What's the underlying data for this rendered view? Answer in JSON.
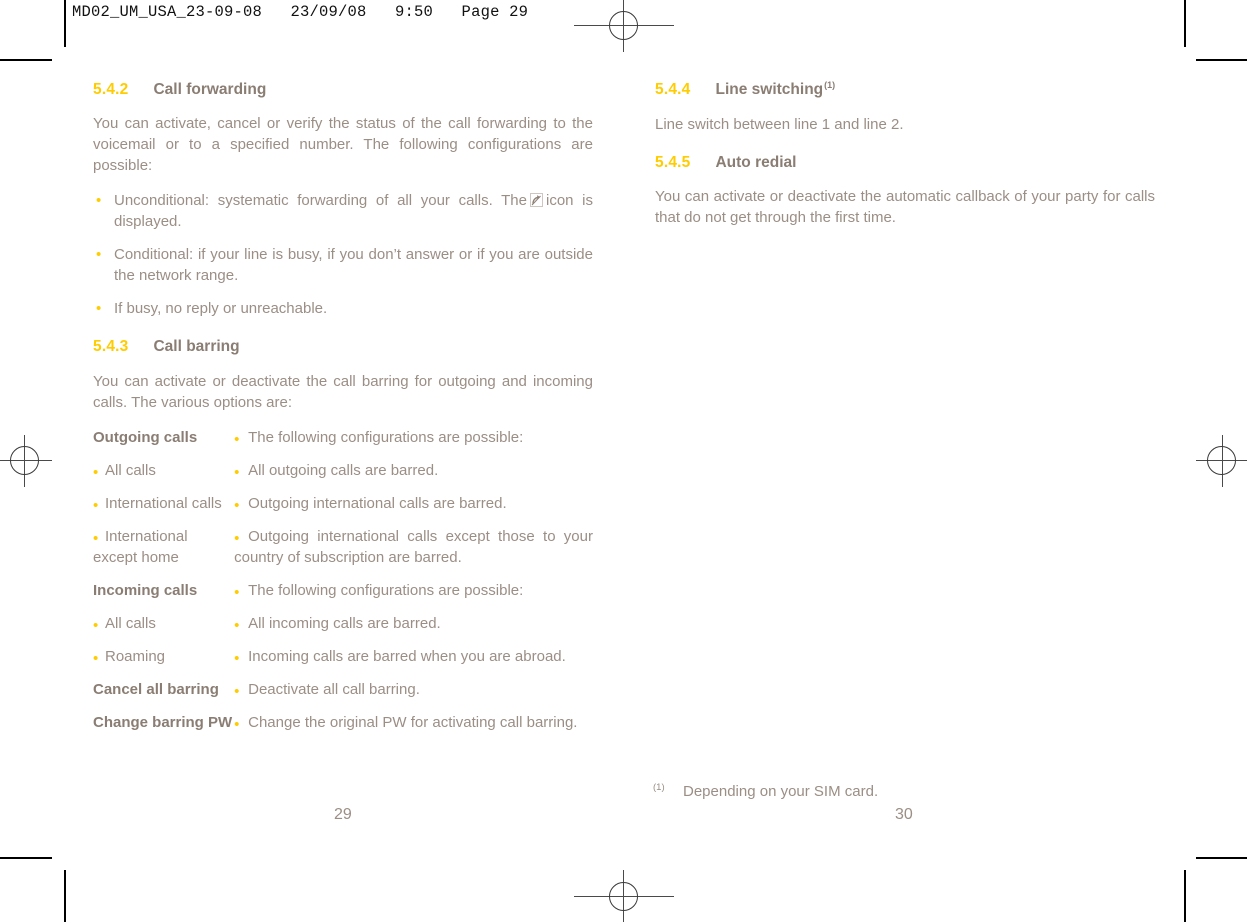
{
  "slug": {
    "text": "MD02_UM_USA_23-09-08   23/09/08   9:50   Page 29"
  },
  "colors": {
    "section_number": "#ffcc00",
    "heading": "#8a7d73",
    "body": "#9b8e85",
    "bullet": "#ffcc00"
  },
  "left_page": {
    "sections": [
      {
        "number": "5.4.2",
        "title": "Call forwarding",
        "intro": "You can activate, cancel or verify the status of the call forwarding to the voicemail or to a specified number. The following configurations are possible:",
        "bullets": [
          {
            "before": "Unconditional: systematic forwarding of all your calls. The",
            "icon": "call-forward-icon",
            "after": "icon is displayed."
          },
          {
            "text": "Conditional: if your line is busy, if you don’t answer or if you are outside the network range."
          },
          {
            "text": "If busy, no reply or unreachable."
          }
        ]
      },
      {
        "number": "5.4.3",
        "title": "Call barring",
        "intro": "You can activate or deactivate the call barring for outgoing and incoming calls. The various options are:"
      }
    ],
    "options_table": {
      "rows": [
        {
          "label": "Outgoing calls",
          "label_bold": true,
          "label_bullet": false,
          "value": "The following configurations are possible:"
        },
        {
          "label": "All calls",
          "label_bold": false,
          "label_bullet": true,
          "value": "All outgoing calls are barred."
        },
        {
          "label": "International calls",
          "label_bold": false,
          "label_bullet": true,
          "value": "Outgoing international calls are barred."
        },
        {
          "label": "International except home",
          "label_bold": false,
          "label_bullet": true,
          "value": "Outgoing international calls except those to your country of subscription are barred."
        },
        {
          "label": "Incoming calls",
          "label_bold": true,
          "label_bullet": false,
          "value": "The following configurations are possible:"
        },
        {
          "label": "All calls",
          "label_bold": false,
          "label_bullet": true,
          "value": "All incoming calls are barred."
        },
        {
          "label": "Roaming",
          "label_bold": false,
          "label_bullet": true,
          "value": "Incoming calls are barred when you are abroad."
        },
        {
          "label": "Cancel all barring",
          "label_bold": true,
          "label_bullet": false,
          "value": "Deactivate all call barring."
        },
        {
          "label": "Change barring PW",
          "label_bold": true,
          "label_bullet": false,
          "value": "Change the original PW for activating call barring."
        }
      ]
    },
    "folio": "29"
  },
  "right_page": {
    "sections": [
      {
        "number": "5.4.4",
        "title": "Line switching",
        "footnote_marker": "(1)",
        "intro": "Line switch between line 1 and line 2."
      },
      {
        "number": "5.4.5",
        "title": "Auto redial",
        "footnote_marker": "",
        "intro": "You can activate or deactivate the automatic callback of your party for calls that do not get through the first time."
      }
    ],
    "footnote": {
      "marker": "(1)",
      "text": "Depending on your SIM card."
    },
    "folio": "30"
  }
}
